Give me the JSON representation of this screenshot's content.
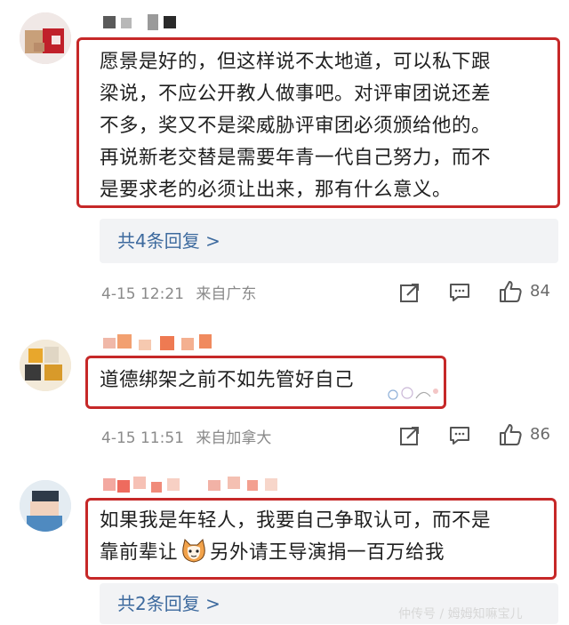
{
  "comments": [
    {
      "text_lines": [
        "愿景是好的，但这样说不太地道，可以私下跟",
        "梁说，不应公开教人做事吧。对评审团说还差",
        "不多，奖又不是梁威胁评审团必须颁给他的。",
        "再说新老交替是需要年青一代自己努力，而不",
        "是要求老的必须让出来，那有什么意义。"
      ],
      "reply_label": "共4条回复 >",
      "date": "4-15 12:21",
      "location": "来自广东",
      "likes": "84"
    },
    {
      "text_lines": [
        "道德绑架之前不如先管好自己"
      ],
      "date": "4-15 11:51",
      "location": "来自加拿大",
      "likes": "86"
    },
    {
      "text_before_emoji": "如果我是年轻人，我要自己争取认可，而不是",
      "text_line2_start": "靠前辈让",
      "text_after_emoji": "另外请王导演捐一百万给我",
      "reply_label": "共2条回复 >"
    }
  ],
  "icons": {
    "share": "share-icon",
    "comment": "comment-icon",
    "like": "thumbs-up-icon",
    "emoji": "cat-emoji-icon"
  },
  "watermark": "仲传号 / 姆姆知嘛宝儿",
  "colors": {
    "highlight_border": "#c62828",
    "reply_link": "#3d6a9e",
    "meta": "#8a8a8a"
  }
}
